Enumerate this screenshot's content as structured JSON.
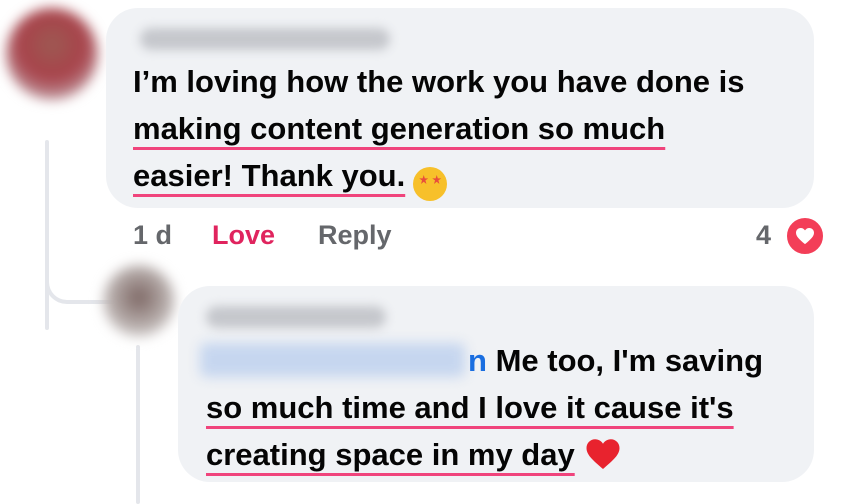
{
  "comment": {
    "lines": [
      "I’m loving how the work you have done is",
      "making content generation so much",
      "easier! Thank you."
    ],
    "emoji": "🤩"
  },
  "actions": {
    "time": "1 d",
    "love_label": "Love",
    "reply_label": "Reply",
    "reaction_count": "4"
  },
  "reply": {
    "mention_tail": "n",
    "lines": [
      "Me too, I'm saving",
      "so much time and I love it cause it's",
      "creating space in my day"
    ],
    "emoji": "❤️"
  },
  "colors": {
    "bubble": "#f0f2f5",
    "love": "#e0245e",
    "highlight": "#f0447c",
    "mention": "#1a6ee0"
  }
}
